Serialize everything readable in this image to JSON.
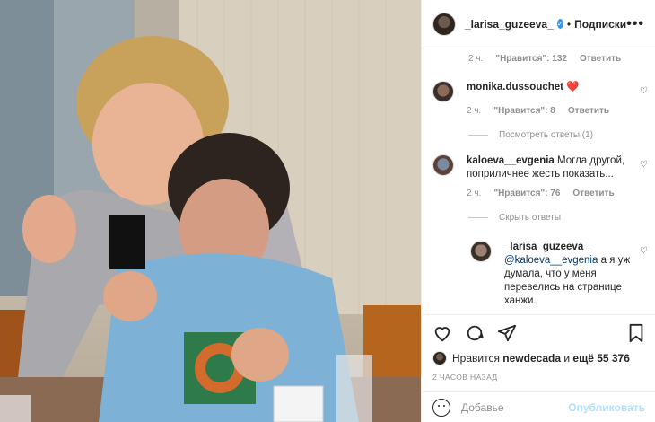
{
  "post": {
    "author": "_larisa_guzeeva_",
    "follow_label": "Подписки",
    "dot": "•",
    "more_label": "•••",
    "verified_glyph": "✓"
  },
  "comments": [
    {
      "time": "2 ч.",
      "likes": "\"Нравится\": 132",
      "reply_label": "Ответить"
    },
    {
      "username": "monika.dussouchet",
      "text": "❤️",
      "time": "2 ч.",
      "likes": "\"Нравится\": 8",
      "reply_label": "Ответить",
      "view_replies": "Посмотреть ответы (1)"
    },
    {
      "username": "kaloeva__evgenia",
      "text": "Могла другой, поприличнее жесть показать...",
      "time": "2 ч.",
      "likes": "\"Нравится\": 76",
      "reply_label": "Ответить",
      "hide_replies": "Скрыть ответы"
    },
    {
      "username": "_larisa_guzeeva_",
      "mention": "@kaloeva__evgenia",
      "text": "а я уж думала, что у меня перевелись на странице ханжи."
    }
  ],
  "likes_line": {
    "prefix": "Нравится",
    "user": "newdecada",
    "middle": "и",
    "count": "ещё 55 376"
  },
  "timestamp": "2 ЧАСОВ НАЗАД",
  "composer": {
    "placeholder": "Добавьте комментарий...",
    "shown_placeholder": "Добавье",
    "publish_label": "Опубликовать"
  },
  "colors": {
    "accent": "#3897f0",
    "heart": "#ed4956",
    "publish_disabled": "#b2dffc"
  },
  "icons": [
    "heart-icon",
    "comment-icon",
    "share-icon",
    "bookmark-icon",
    "emoji-icon",
    "more-icon",
    "verified-icon"
  ]
}
